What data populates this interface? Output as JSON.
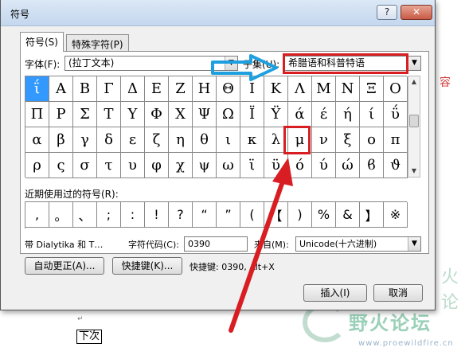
{
  "background": {
    "side_text": "容",
    "watermark_text": "野火论坛",
    "watermark_url": "www.proewildfire.cn",
    "watermark_side": "火论",
    "para_mark": "↵",
    "doc_word": "下次"
  },
  "dialog": {
    "title": "符号",
    "help_label": "?",
    "close_label": "✕",
    "tabs": [
      {
        "label": "符号(S)"
      },
      {
        "label": "特殊字符(P)"
      }
    ],
    "font_label": "字体(F):",
    "font_value": "(拉丁文本)",
    "subset_label": "子集(U):",
    "subset_value": "希腊语和科普特语",
    "symbols": [
      "ΐ",
      "Α",
      "Β",
      "Γ",
      "Δ",
      "Ε",
      "Ζ",
      "Η",
      "Θ",
      "Ι",
      "Κ",
      "Λ",
      "Μ",
      "Ν",
      "Ξ",
      "Ο",
      "Π",
      "Ρ",
      "Σ",
      "Τ",
      "Υ",
      "Φ",
      "Χ",
      "Ψ",
      "Ω",
      "Ϊ",
      "Ϋ",
      "ά",
      "έ",
      "ή",
      "ί",
      "ΰ",
      "α",
      "β",
      "γ",
      "δ",
      "ε",
      "ζ",
      "η",
      "θ",
      "ι",
      "κ",
      "λ",
      "μ",
      "ν",
      "ξ",
      "ο",
      "π",
      "ρ",
      "ς",
      "σ",
      "τ",
      "υ",
      "φ",
      "χ",
      "ψ",
      "ω",
      "ϊ",
      "ϋ",
      "ό",
      "ύ",
      "ώ",
      "ϐ",
      "ϑ"
    ],
    "recent_label": "近期使用过的符号(R):",
    "recent_symbols": [
      ",",
      "。",
      "、",
      ";",
      ":",
      "!",
      "?",
      "“",
      "”",
      "(",
      "【",
      ")",
      "%",
      "&",
      "】",
      "※"
    ],
    "char_name": "带 Dialytika 和 T…",
    "char_code_label": "字符代码(C):",
    "char_code_value": "0390",
    "from_label": "来自(M):",
    "from_value": "Unicode(十六进制)",
    "autocorrect_label": "自动更正(A)...",
    "shortcut_key_label": "快捷键(K)...",
    "shortcut_info": "快捷键: 0390, Alt+X",
    "insert_label": "插入(I)",
    "cancel_label": "取消"
  },
  "colors": {
    "selection": "#3399ff",
    "annotation_red": "#d81e22",
    "annotation_blue": "#1ea0e0"
  }
}
